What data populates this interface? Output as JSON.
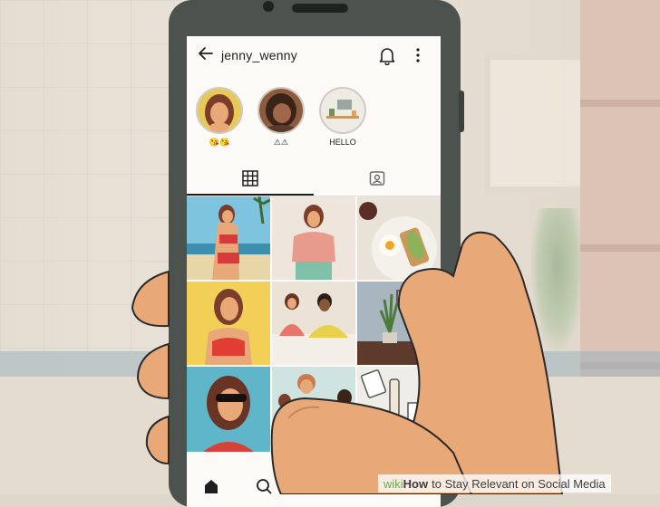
{
  "header": {
    "back_icon": "arrow-left-icon",
    "username": "jenny_wenny",
    "bell_icon": "bell-icon",
    "more_icon": "more-vertical-icon"
  },
  "highlights": [
    {
      "label": "😘😘",
      "art": "woman-yellow-portrait"
    },
    {
      "label": "⚠⚠",
      "art": "woman-brown-portrait"
    },
    {
      "label": "HELLO",
      "art": "desk-scene"
    }
  ],
  "tabs": [
    {
      "icon": "grid-icon",
      "active": true
    },
    {
      "icon": "tagged-icon",
      "active": false
    }
  ],
  "grid_posts": [
    "woman-beach-swimsuit",
    "woman-pink-sweater",
    "avocado-toast-breakfast",
    "woman-red-top-yellow-bg",
    "couple-dinner",
    "plant-and-lamp",
    "woman-sunglasses",
    "friends-group",
    "stationery-desk"
  ],
  "nav": [
    {
      "icon": "home-icon"
    },
    {
      "icon": "search-icon"
    },
    {
      "icon": "reels-icon"
    }
  ],
  "caption": {
    "brand_a": "wiki",
    "brand_b": "How",
    "text": "to Stay Relevant on Social Media"
  },
  "colors": {
    "phone_body": "#4c524d",
    "screen_bg": "#fbfaf7",
    "skin": "#e9a878",
    "brand_green": "#6aa84f"
  }
}
